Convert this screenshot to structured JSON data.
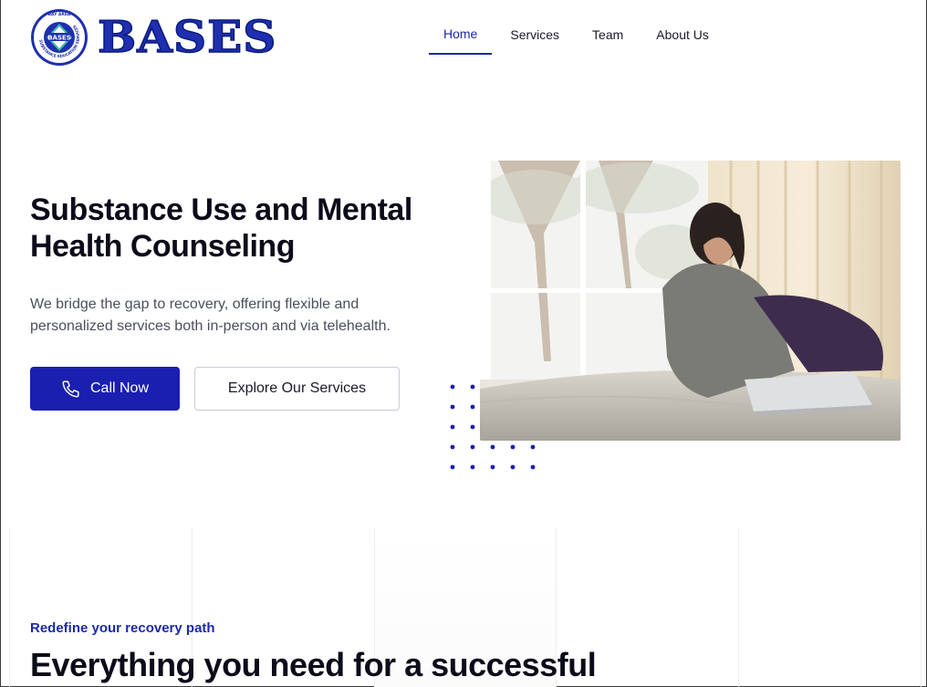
{
  "brand": {
    "name": "BASES",
    "seal_top": "BAY AREA",
    "seal_ring": "SUBSTANCE EDUCATION SERVICES",
    "seal_center": "BASES",
    "color": "#1f2fb0"
  },
  "nav": {
    "items": [
      {
        "label": "Home",
        "active": true
      },
      {
        "label": "Services",
        "active": false
      },
      {
        "label": "Team",
        "active": false
      },
      {
        "label": "About Us",
        "active": false
      }
    ]
  },
  "hero": {
    "title": "Substance Use and Mental Health Counseling",
    "subtitle": "We bridge the gap to recovery, offering flexible and personalized services both in-person and via telehealth.",
    "primary_button": "Call Now",
    "secondary_button": "Explore Our Services",
    "icon": "phone-icon",
    "accent": "#1a1fb0"
  },
  "section": {
    "eyebrow": "Redefine your recovery path",
    "title": "Everything you need for a successful"
  }
}
